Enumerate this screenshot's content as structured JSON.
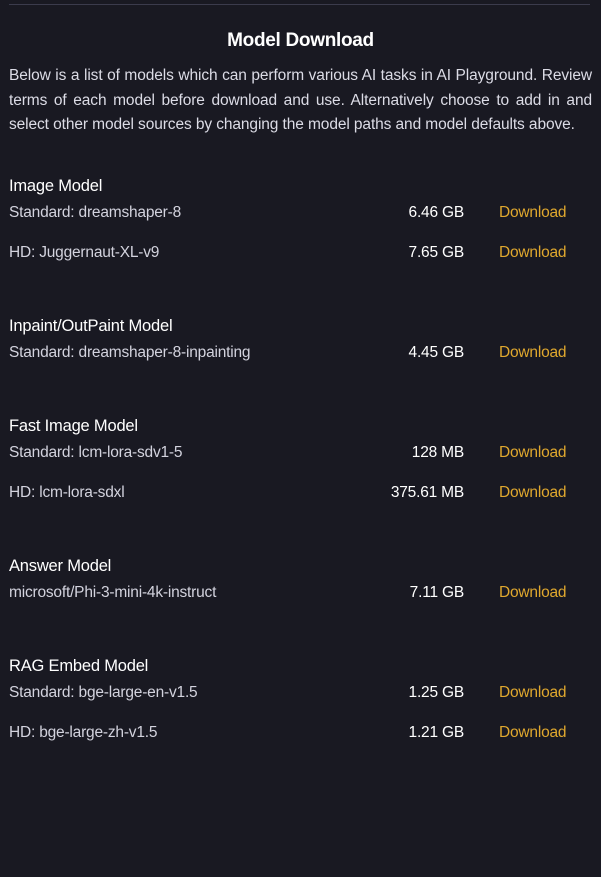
{
  "header": {
    "title": "Model Download",
    "intro": "Below is a list of models which can perform various AI tasks in AI Playground. Review terms of each model before download and use. Alternatively choose to add in and select other model sources by changing the model paths and model defaults above."
  },
  "colors": {
    "background": "#191922",
    "divider": "#3b3b4c",
    "title": "#ffffff",
    "body_text": "#dcdce6",
    "model_name": "#d3d3de",
    "size_text": "#ffffff",
    "download_link": "#e0a82e"
  },
  "action_label": "Download",
  "sections": [
    {
      "title": "Image Model",
      "rows": [
        {
          "name": "Standard: dreamshaper-8",
          "size": "6.46 GB",
          "action": "Download"
        },
        {
          "name": "HD: Juggernaut-XL-v9",
          "size": "7.65 GB",
          "action": "Download"
        }
      ]
    },
    {
      "title": "Inpaint/OutPaint Model",
      "rows": [
        {
          "name": "Standard: dreamshaper-8-inpainting",
          "size": "4.45 GB",
          "action": "Download"
        }
      ]
    },
    {
      "title": "Fast Image Model",
      "rows": [
        {
          "name": "Standard: lcm-lora-sdv1-5",
          "size": "128 MB",
          "action": "Download"
        },
        {
          "name": "HD: lcm-lora-sdxl",
          "size": "375.61 MB",
          "action": "Download"
        }
      ]
    },
    {
      "title": "Answer Model",
      "rows": [
        {
          "name": "microsoft/Phi-3-mini-4k-instruct",
          "size": "7.11 GB",
          "action": "Download"
        }
      ]
    },
    {
      "title": "RAG Embed Model",
      "rows": [
        {
          "name": "Standard: bge-large-en-v1.5",
          "size": "1.25 GB",
          "action": "Download"
        },
        {
          "name": "HD: bge-large-zh-v1.5",
          "size": "1.21 GB",
          "action": "Download"
        }
      ]
    }
  ]
}
